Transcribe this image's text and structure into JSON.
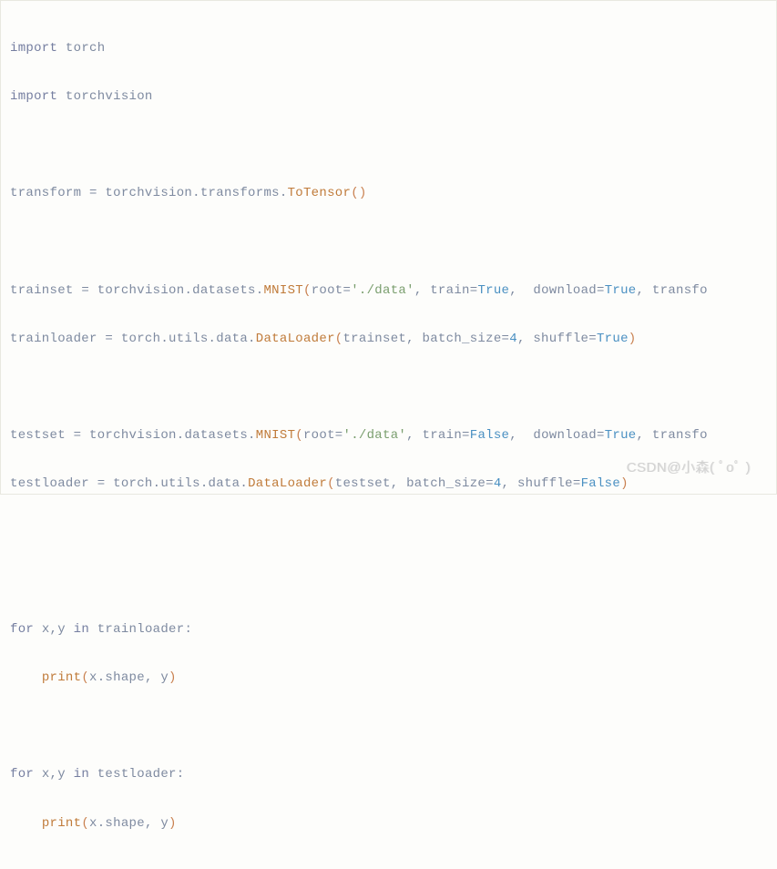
{
  "code": {
    "line1": {
      "kw": "import",
      "mod": "torch"
    },
    "line2": {
      "kw": "import",
      "mod": "torchvision"
    },
    "line3": {
      "var": "transform",
      "eq": "=",
      "mods": "torchvision.transforms.",
      "fn": "ToTensor",
      "paren": "()"
    },
    "line4": {
      "var": "trainset",
      "eq": "=",
      "mods": "torchvision.datasets.",
      "fn": "MNIST",
      "lp": "(",
      "root_k": "root",
      "root_v": "'./data'",
      "train_k": "train",
      "train_v": "True",
      "down_k": "download",
      "down_v": "True",
      "trans_k": "transfo"
    },
    "line5": {
      "var": "trainloader",
      "eq": "=",
      "mods": "torch.utils.data.",
      "fn": "DataLoader",
      "lp": "(",
      "a1": "trainset",
      "bs_k": "batch_size",
      "bs_v": "4",
      "sh_k": "shuffle",
      "sh_v": "True",
      "rp": ")"
    },
    "line6": {
      "var": "testset",
      "eq": "=",
      "mods": "torchvision.datasets.",
      "fn": "MNIST",
      "lp": "(",
      "root_k": "root",
      "root_v": "'./data'",
      "train_k": "train",
      "train_v": "False",
      "down_k": "download",
      "down_v": "True",
      "trans_k": "transfo"
    },
    "line7": {
      "var": "testloader",
      "eq": "=",
      "mods": "torch.utils.data.",
      "fn": "DataLoader",
      "lp": "(",
      "a1": "testset",
      "bs_k": "batch_size",
      "bs_v": "4",
      "sh_k": "shuffle",
      "sh_v": "False",
      "rp": ")"
    },
    "line8": {
      "for": "for",
      "xy": "x,y",
      "in": "in",
      "it": "trainloader",
      "colon": ":"
    },
    "line9": {
      "indent": "    ",
      "fn": "print",
      "lp": "(",
      "a": "x.shape, y",
      "rp": ")"
    },
    "line10": {
      "for": "for",
      "xy": "x,y",
      "in": "in",
      "it": "testloader",
      "colon": ":"
    },
    "line11": {
      "indent": "    ",
      "fn": "print",
      "lp": "(",
      "a": "x.shape, y",
      "rp": ")"
    }
  },
  "watermark": "CSDN@小森( ﾟoﾟ )"
}
